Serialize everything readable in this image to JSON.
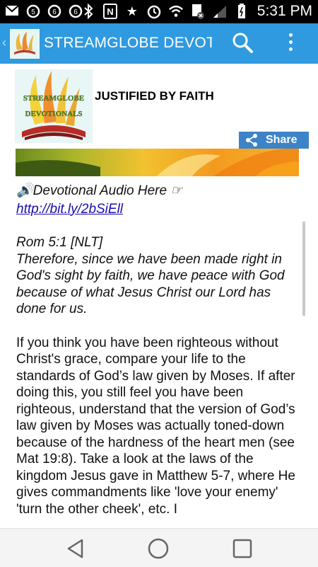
{
  "status_bar": {
    "time": "5:31 PM",
    "left_icons": [
      "mail-icon",
      "alarm-icon",
      "alarm-icon",
      "alarm-icon"
    ],
    "right_icons": [
      "bluetooth-icon",
      "nfc-icon",
      "star-icon",
      "alarm-clock-icon",
      "wifi-icon",
      "no-sim-icon",
      "signal-icon",
      "battery-icon"
    ]
  },
  "action_bar": {
    "title": "STREAMGLOBE DEVOTIONALS",
    "background": "#2f9ae0"
  },
  "post": {
    "logo_text_line1": "STREAMGLOBE",
    "logo_text_line2": "DEVOTIONALS",
    "title": "JUSTIFIED BY FAITH",
    "share_label": "Share",
    "audio_label": "🔊Devotional Audio Here ☞",
    "audio_link": "http://bit.ly/2bSiEll",
    "verse_ref": "Rom 5:1 [NLT]",
    "verse_text": "Therefore, since we have been made right in God's sight by faith, we have peace with God because of what Jesus Christ our Lord has done for us.",
    "body": "If you think you have been righteous without Christ's grace, compare your life to the standards of God’s law given by Moses. If after doing this, you still feel you have been righteous, understand that the version of God’s law given by Moses was actually toned-down because of the hardness of the heart men (see Mat 19:8). Take a look at the laws of the kingdom Jesus gave in Matthew 5-7, where He gives commandments like 'love your enemy' 'turn the other cheek', etc. I"
  },
  "nav": {
    "buttons": [
      "back-icon",
      "home-icon",
      "recents-icon"
    ]
  }
}
